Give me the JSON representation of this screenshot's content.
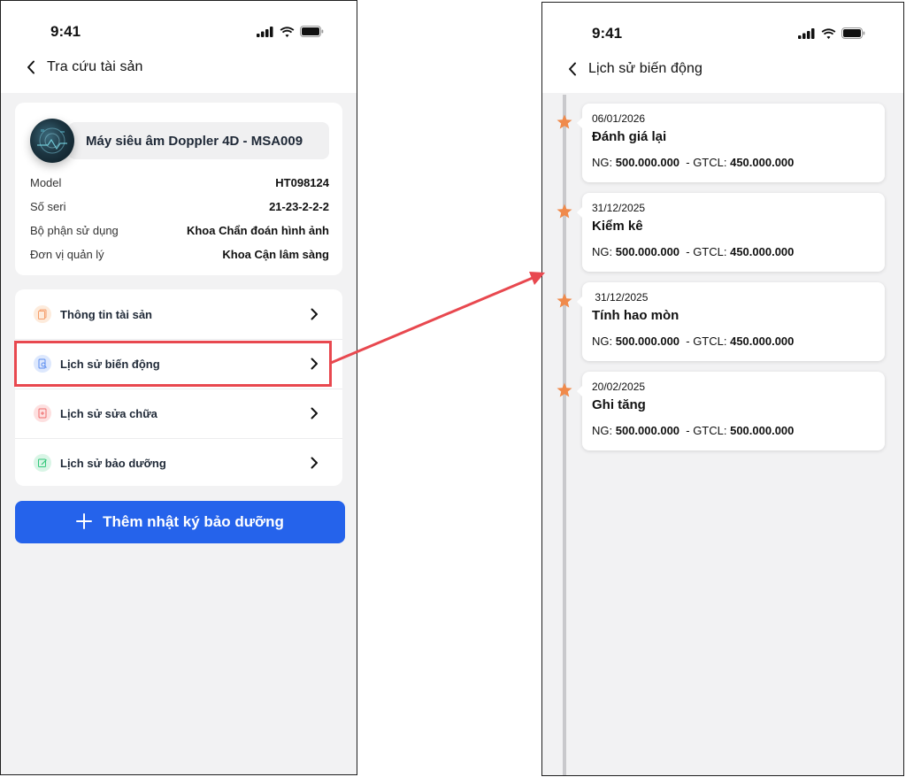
{
  "left_screen": {
    "status_time": "9:41",
    "header_title": "Tra cứu tài sản",
    "asset": {
      "name": "Máy siêu âm Doppler 4D - MSA009",
      "fields": [
        {
          "label": "Model",
          "value": "HT098124"
        },
        {
          "label": "Số seri",
          "value": "21-23-2-2-2"
        },
        {
          "label": "Bộ phận sử dụng",
          "value": "Khoa Chẩn đoán hình ảnh"
        },
        {
          "label": "Đơn vị quản lý",
          "value": "Khoa Cận lâm sàng"
        }
      ]
    },
    "menu": [
      {
        "label": "Thông tin tài sản",
        "icon": "documents-icon",
        "color": "#f59e6b"
      },
      {
        "label": "Lịch sử biến động",
        "icon": "file-search-icon",
        "color": "#5b8def"
      },
      {
        "label": "Lịch sử sửa chữa",
        "icon": "file-repair-icon",
        "color": "#ef6b6b"
      },
      {
        "label": "Lịch sử bảo dưỡng",
        "icon": "edit-check-icon",
        "color": "#34c77b"
      }
    ],
    "primary_button": "Thêm nhật ký bảo dưỡng"
  },
  "right_screen": {
    "status_time": "9:41",
    "header_title": "Lịch sử biến động",
    "events": [
      {
        "date": "06/01/2026",
        "title": "Đánh giá lại",
        "ng_label": "NG: ",
        "ng": "500.000.000",
        "gtcl_label": "  - GTCL: ",
        "gtcl": "450.000.000"
      },
      {
        "date": "31/12/2025",
        "title": "Kiểm kê",
        "ng_label": "NG: ",
        "ng": "500.000.000",
        "gtcl_label": "  - GTCL: ",
        "gtcl": "450.000.000"
      },
      {
        "date": " 31/12/2025",
        "title": "Tính hao mòn",
        "ng_label": "NG: ",
        "ng": "500.000.000",
        "gtcl_label": "  - GTCL: ",
        "gtcl": "450.000.000"
      },
      {
        "date": "20/02/2025",
        "title": "Ghi tăng",
        "ng_label": "NG: ",
        "ng": "500.000.000",
        "gtcl_label": "  - GTCL: ",
        "gtcl": "500.000.000"
      }
    ]
  },
  "colors": {
    "primary": "#2563eb",
    "highlight": "#e8484f",
    "star": "#f08a4b",
    "timeline": "#c9c9cc"
  }
}
